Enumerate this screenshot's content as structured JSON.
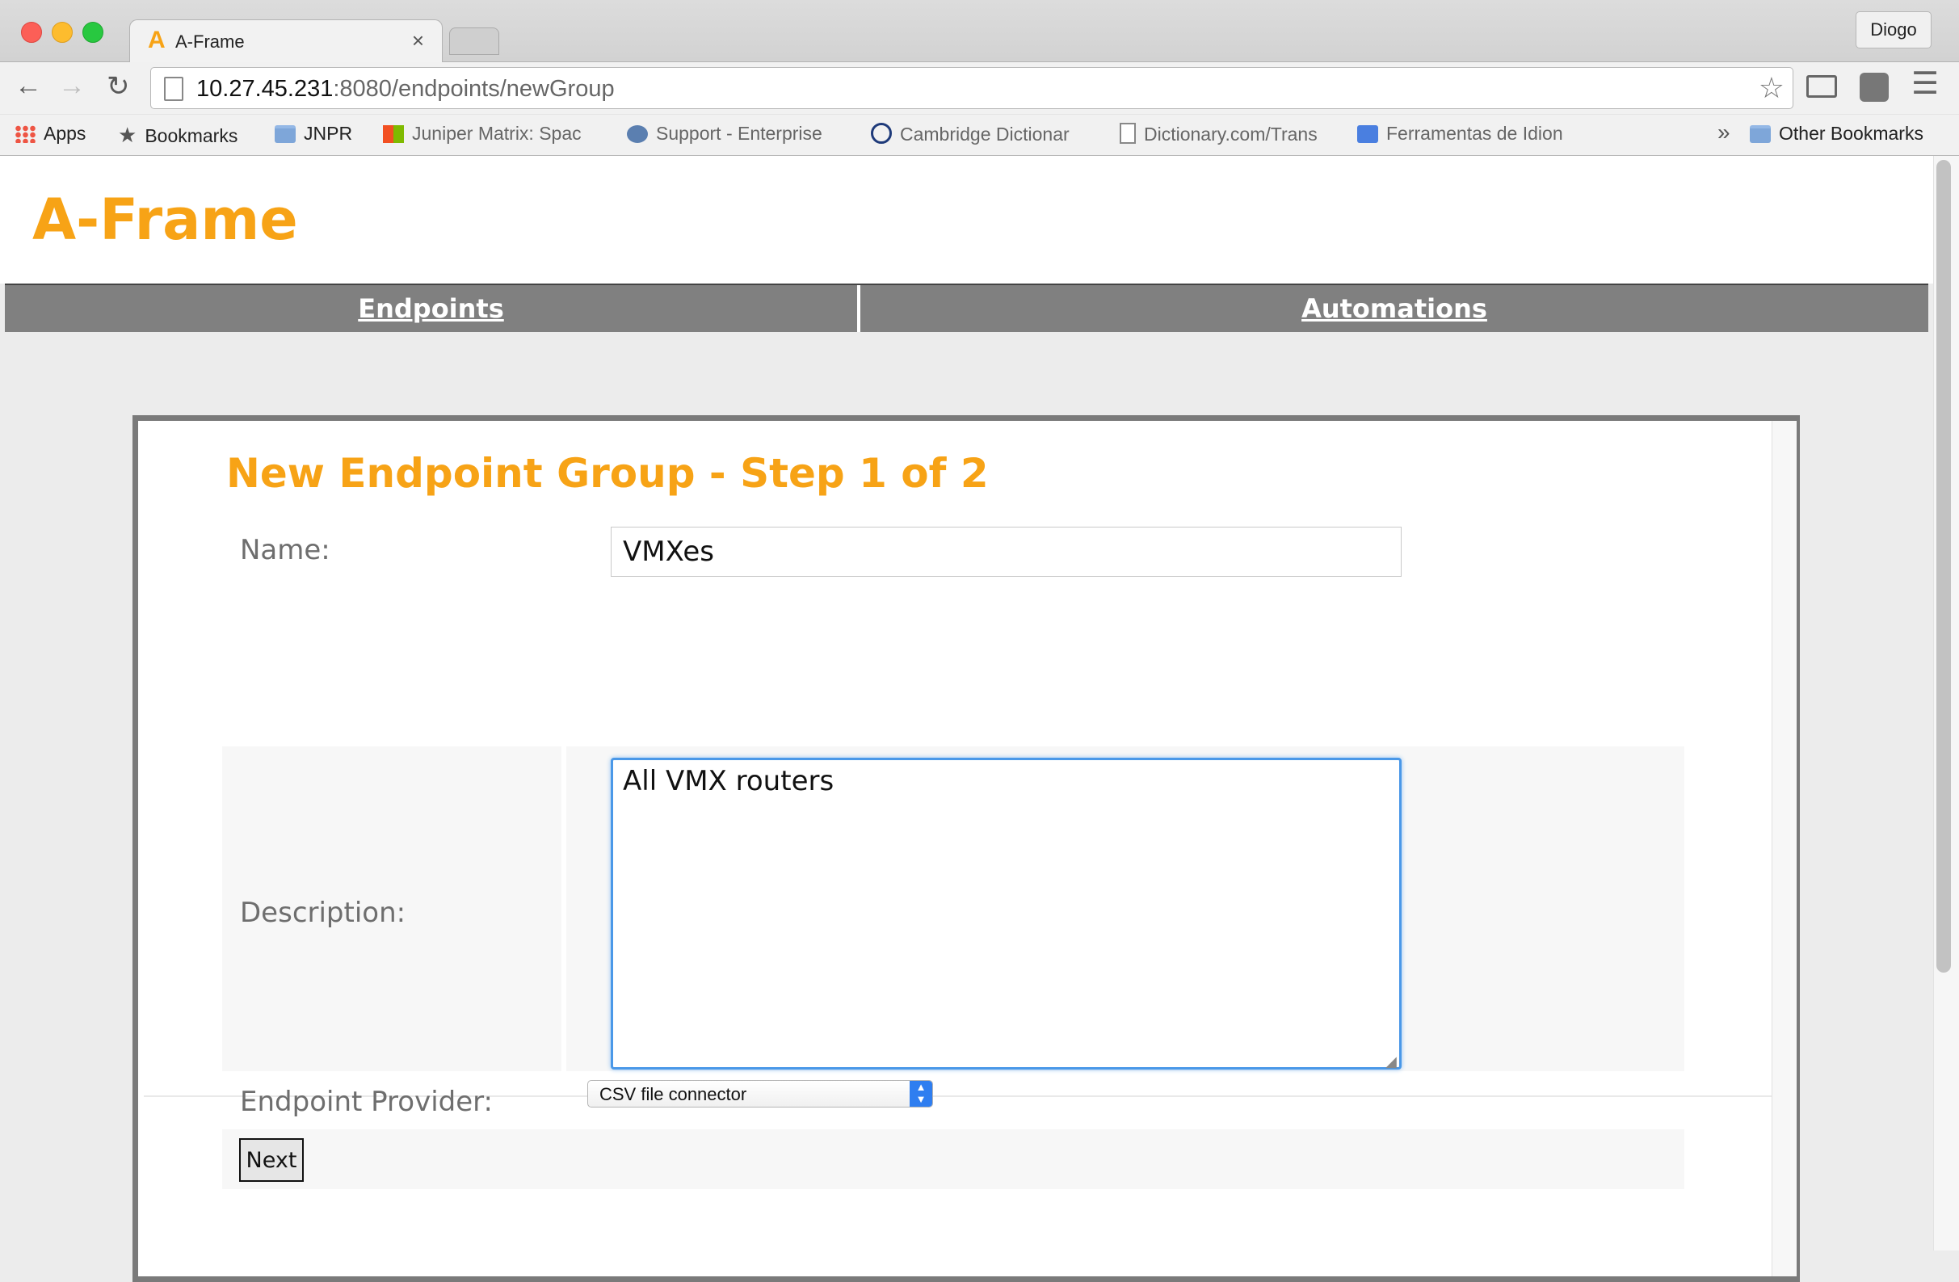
{
  "browser": {
    "tab_title": "A-Frame",
    "tab_favicon": "A",
    "tab_close": "×",
    "profile_name": "Diogo",
    "url_host": "10.27.45.231",
    "url_path": ":8080/endpoints/newGroup",
    "bookmarks": [
      {
        "label": "Apps",
        "icon": "apps-grid-icon"
      },
      {
        "label": "Bookmarks",
        "icon": "star-icon"
      },
      {
        "label": "JNPR",
        "icon": "folder-icon"
      },
      {
        "label": "Juniper Matrix: Spac",
        "icon": "microsoft-icon"
      },
      {
        "label": "Support - Enterprise",
        "icon": "support-icon"
      },
      {
        "label": "Cambridge Dictionar",
        "icon": "cambridge-icon"
      },
      {
        "label": "Dictionary.com/Trans",
        "icon": "document-icon"
      },
      {
        "label": "Ferramentas de Idion",
        "icon": "google-translate-icon"
      }
    ],
    "bookmarks_overflow": "»",
    "other_bookmarks": "Other Bookmarks"
  },
  "page": {
    "brand": "A-Frame",
    "nav": {
      "endpoints": "Endpoints",
      "automations": "Automations"
    }
  },
  "form": {
    "title": "New Endpoint Group - Step 1 of 2",
    "name_label": "Name:",
    "name_value": "VMXes",
    "description_label": "Description:",
    "description_value": "All VMX routers",
    "provider_label": "Endpoint Provider:",
    "provider_selected": "CSV file connector",
    "next_label": "Next"
  },
  "colors": {
    "brand_orange": "#f7a316",
    "nav_gray": "#808080",
    "focus_blue": "#4a98e8"
  }
}
